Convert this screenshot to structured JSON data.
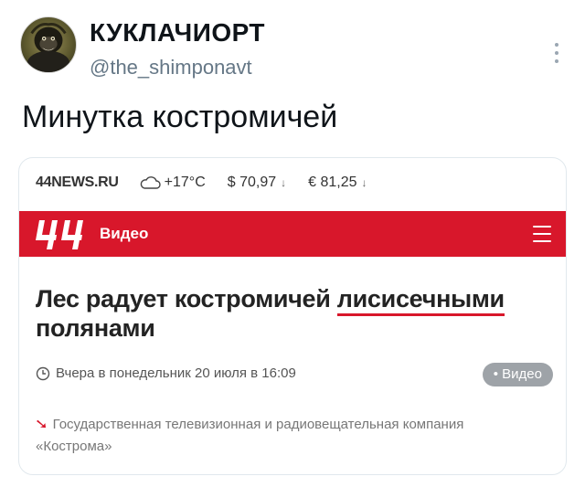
{
  "tweet": {
    "author": {
      "display_name": "КУКЛАЧИОРТ",
      "handle": "@the_shimponavt",
      "avatar_icon": "gorilla-avatar"
    },
    "more_icon": "more-vertical-icon",
    "text": "Минутка костромичей"
  },
  "card": {
    "topbar": {
      "site": "44NEWS.RU",
      "weather": "+17°С",
      "usd": "$ 70,97",
      "usd_trend": "↓",
      "eur": "€ 81,25",
      "eur_trend": "↓"
    },
    "nav": {
      "label": "Видео",
      "menu_icon": "hamburger-icon",
      "brand_color": "#d8172b"
    },
    "headline": {
      "part1": "Лес радует костромичей ",
      "underlined": "лисисечными",
      "part2": "полянами"
    },
    "meta": {
      "date": "Вчера в понедельник 20 июля в 16:09",
      "badge": "Видео"
    },
    "source": {
      "text": "Государственная телевизионная и радиовещательная компания «Кострома»"
    }
  }
}
